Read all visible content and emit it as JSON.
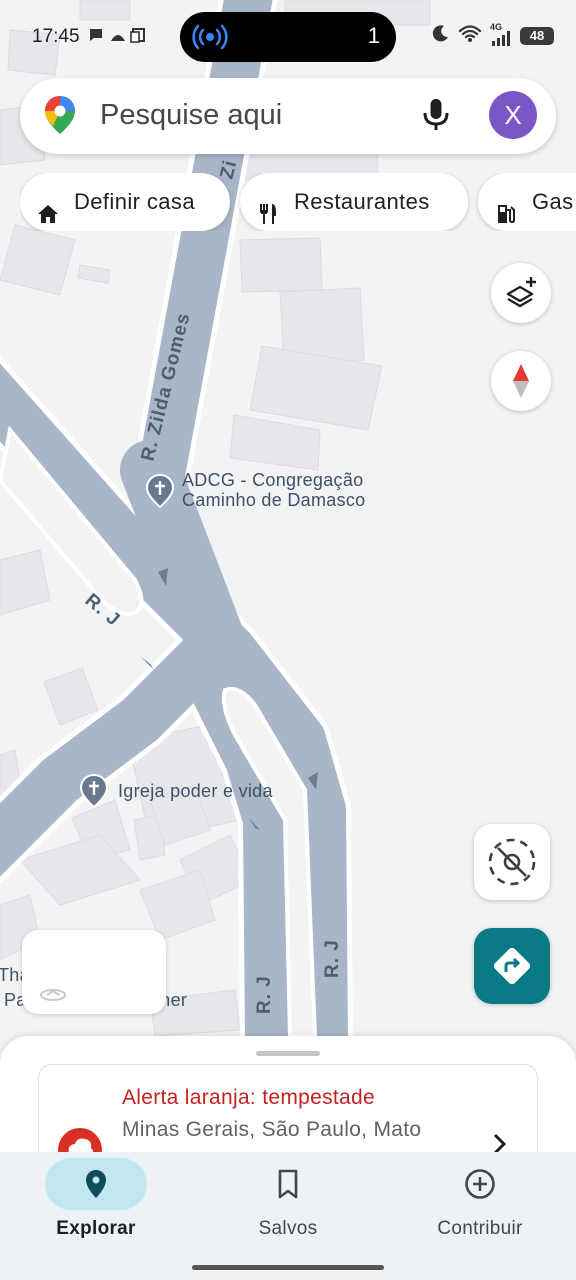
{
  "status_bar": {
    "time": "17:45",
    "notification_count": "1",
    "network": "4G",
    "battery": "48"
  },
  "search": {
    "placeholder": "Pesquise aqui",
    "avatar_letter": "X",
    "avatar_color": "#7b57c6"
  },
  "chips": [
    {
      "label": "Definir casa",
      "icon": "home-icon"
    },
    {
      "label": "Restaurantes",
      "icon": "fork-knife-icon"
    },
    {
      "label": "Gas",
      "icon": "fuel-pump-icon"
    }
  ],
  "map": {
    "street_labels": [
      "R. Zilda Gomes",
      "R. J",
      "R. J",
      "R. J",
      "Zi"
    ],
    "places": [
      {
        "line1": "ADCG - Congregação",
        "line2": "Caminho de Damasco",
        "icon": "church-pin-icon"
      },
      {
        "line1": "Igreja poder e vida",
        "icon": "church-pin-icon"
      }
    ],
    "partial_labels": [
      "Tha",
      "Pa",
      "gner"
    ],
    "accent_teal": "#0b7a87"
  },
  "alert": {
    "title": "Alerta laranja: tempestade",
    "subtitle": "Minas Gerais, São Paulo, Mato",
    "title_color": "#c5221f"
  },
  "nav": [
    {
      "label": "Explorar",
      "icon": "pin-icon",
      "active": true
    },
    {
      "label": "Salvos",
      "icon": "bookmark-icon",
      "active": false
    },
    {
      "label": "Contribuir",
      "icon": "plus-circle-icon",
      "active": false
    }
  ]
}
